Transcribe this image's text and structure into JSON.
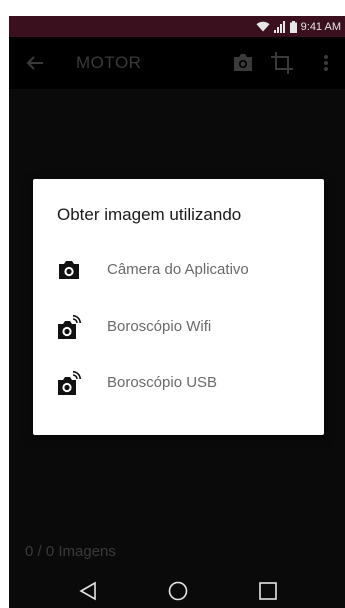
{
  "status_bar": {
    "time": "9:41 AM",
    "icons": [
      "wifi-icon",
      "signal-icon",
      "battery-icon"
    ]
  },
  "app_bar": {
    "title": "MOTOR",
    "actions": [
      "camera-icon",
      "crop-icon",
      "more-vert-icon"
    ]
  },
  "dialog": {
    "title": "Obter imagem utilizando",
    "options": [
      {
        "label": "Câmera do Aplicativo",
        "icon": "camera-icon"
      },
      {
        "label": "Boroscópio Wifi",
        "icon": "wireless-camera-icon"
      },
      {
        "label": "Boroscópio USB",
        "icon": "wireless-camera-icon"
      }
    ]
  },
  "footer": {
    "image_count": "0 / 0 Imagens"
  },
  "nav_bar": {
    "buttons": [
      "back-icon",
      "home-icon",
      "recents-icon"
    ]
  },
  "colors": {
    "status_bar": "#3a0f1e",
    "background": "#0a0a0a",
    "dialog": "#ffffff"
  }
}
